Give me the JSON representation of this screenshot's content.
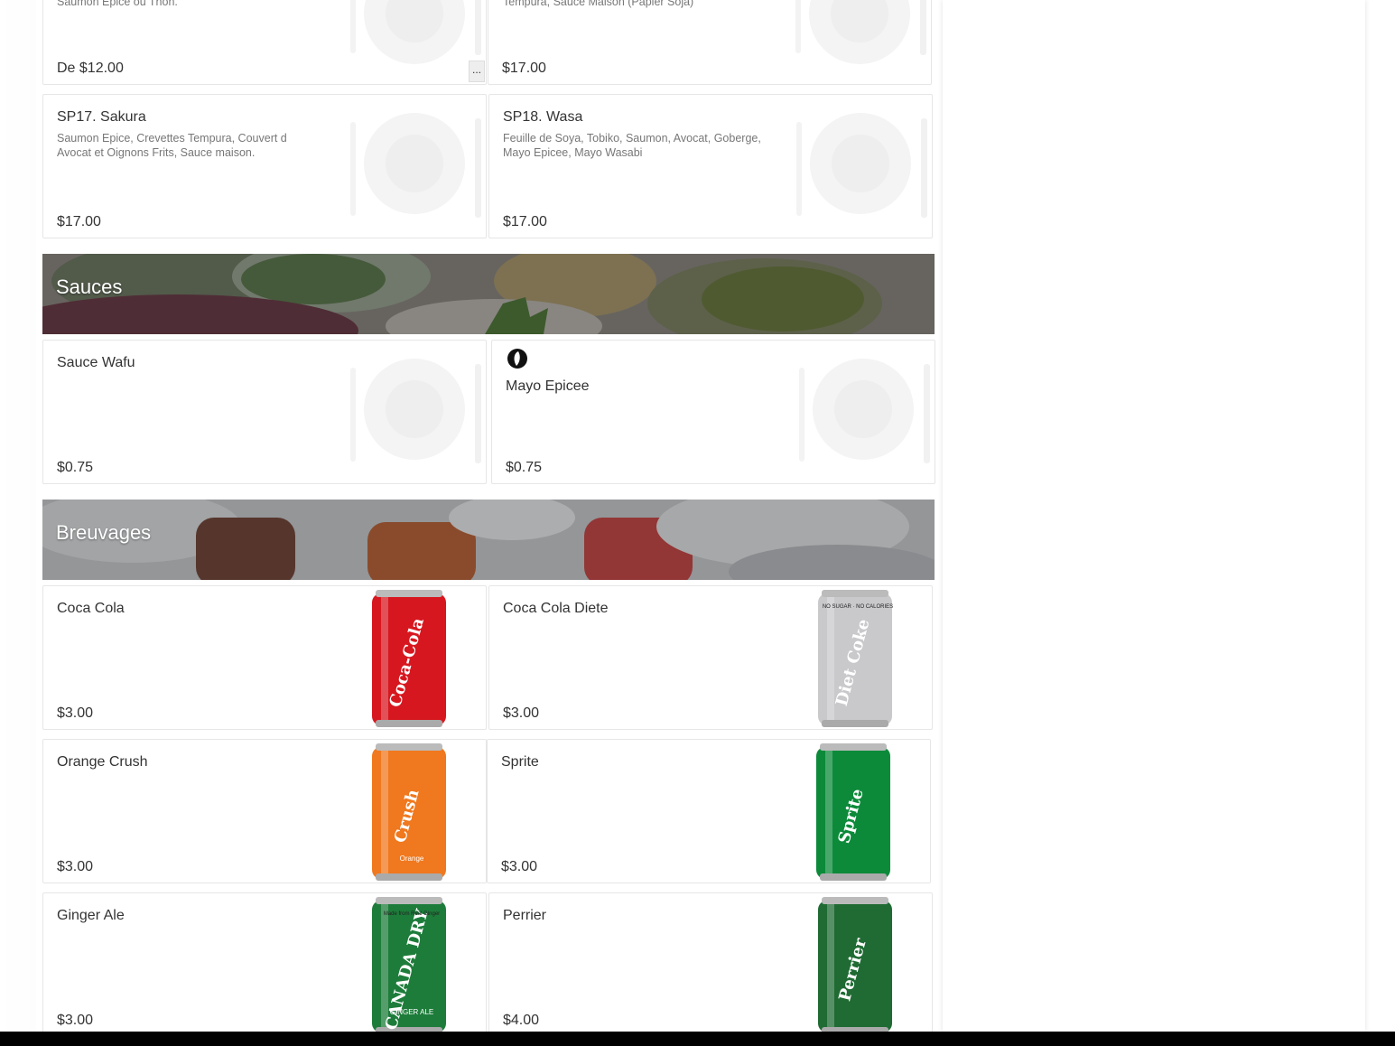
{
  "top_row": [
    {
      "desc": "Saumon Epice ou Thon.",
      "price": "De $12.00",
      "more": "..."
    },
    {
      "desc": "Tempura, Sauce Maison (Papier Soja)",
      "price": "$17.00"
    }
  ],
  "specials": [
    {
      "name": "SP17. Sakura",
      "desc": "Saumon Epice, Crevettes Tempura, Couvert d Avocat et Oignons Frits, Sauce maison.",
      "price": "$17.00"
    },
    {
      "name": "SP18. Wasa",
      "desc": "Feuille de Soya, Tobiko, Saumon, Avocat, Goberge, Mayo Epicee, Mayo Wasabi",
      "price": "$17.00"
    }
  ],
  "sauces": {
    "title": "Sauces",
    "items": [
      {
        "name": "Sauce Wafu",
        "price": "$0.75"
      },
      {
        "name": "Mayo Epicee",
        "price": "$0.75",
        "icon": "spicy-pepper-icon"
      }
    ]
  },
  "breuvages": {
    "title": "Breuvages",
    "items": [
      {
        "name": "Coca Cola",
        "price": "$3.00",
        "can_label": "Coca-Cola",
        "color": "#d7171f"
      },
      {
        "name": "Coca Cola Diete",
        "price": "$3.00",
        "can_label": "Diet Coke",
        "can_top": "NO SUGAR · NO CALORIES",
        "color": "#c9c9cc"
      },
      {
        "name": "Orange Crush",
        "price": "$3.00",
        "can_label": "Crush",
        "can_sub": "Orange",
        "color": "#f0781e"
      },
      {
        "name": "Sprite",
        "price": "$3.00",
        "can_label": "Sprite",
        "color": "#0c8a3a"
      },
      {
        "name": "Ginger Ale",
        "price": "$3.00",
        "can_label": "CANADA DRY",
        "can_sub": "GINGER ALE",
        "can_top": "Made from Real Ginger",
        "color": "#1d7c3a"
      },
      {
        "name": "Perrier",
        "price": "$4.00",
        "can_label": "Perrier",
        "color": "#1f6b33"
      }
    ]
  }
}
